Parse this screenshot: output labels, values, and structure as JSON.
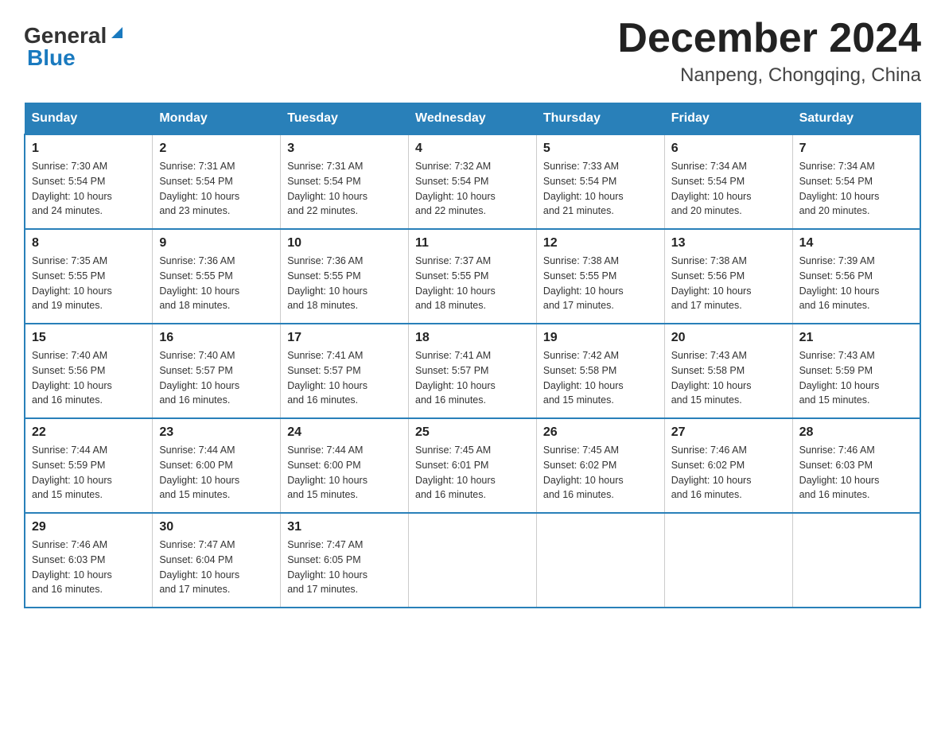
{
  "header": {
    "logo_general": "General",
    "logo_blue": "Blue",
    "month_title": "December 2024",
    "location": "Nanpeng, Chongqing, China"
  },
  "days_of_week": [
    "Sunday",
    "Monday",
    "Tuesday",
    "Wednesday",
    "Thursday",
    "Friday",
    "Saturday"
  ],
  "weeks": [
    [
      {
        "day": "1",
        "sunrise": "7:30 AM",
        "sunset": "5:54 PM",
        "daylight": "10 hours and 24 minutes."
      },
      {
        "day": "2",
        "sunrise": "7:31 AM",
        "sunset": "5:54 PM",
        "daylight": "10 hours and 23 minutes."
      },
      {
        "day": "3",
        "sunrise": "7:31 AM",
        "sunset": "5:54 PM",
        "daylight": "10 hours and 22 minutes."
      },
      {
        "day": "4",
        "sunrise": "7:32 AM",
        "sunset": "5:54 PM",
        "daylight": "10 hours and 22 minutes."
      },
      {
        "day": "5",
        "sunrise": "7:33 AM",
        "sunset": "5:54 PM",
        "daylight": "10 hours and 21 minutes."
      },
      {
        "day": "6",
        "sunrise": "7:34 AM",
        "sunset": "5:54 PM",
        "daylight": "10 hours and 20 minutes."
      },
      {
        "day": "7",
        "sunrise": "7:34 AM",
        "sunset": "5:54 PM",
        "daylight": "10 hours and 20 minutes."
      }
    ],
    [
      {
        "day": "8",
        "sunrise": "7:35 AM",
        "sunset": "5:55 PM",
        "daylight": "10 hours and 19 minutes."
      },
      {
        "day": "9",
        "sunrise": "7:36 AM",
        "sunset": "5:55 PM",
        "daylight": "10 hours and 18 minutes."
      },
      {
        "day": "10",
        "sunrise": "7:36 AM",
        "sunset": "5:55 PM",
        "daylight": "10 hours and 18 minutes."
      },
      {
        "day": "11",
        "sunrise": "7:37 AM",
        "sunset": "5:55 PM",
        "daylight": "10 hours and 18 minutes."
      },
      {
        "day": "12",
        "sunrise": "7:38 AM",
        "sunset": "5:55 PM",
        "daylight": "10 hours and 17 minutes."
      },
      {
        "day": "13",
        "sunrise": "7:38 AM",
        "sunset": "5:56 PM",
        "daylight": "10 hours and 17 minutes."
      },
      {
        "day": "14",
        "sunrise": "7:39 AM",
        "sunset": "5:56 PM",
        "daylight": "10 hours and 16 minutes."
      }
    ],
    [
      {
        "day": "15",
        "sunrise": "7:40 AM",
        "sunset": "5:56 PM",
        "daylight": "10 hours and 16 minutes."
      },
      {
        "day": "16",
        "sunrise": "7:40 AM",
        "sunset": "5:57 PM",
        "daylight": "10 hours and 16 minutes."
      },
      {
        "day": "17",
        "sunrise": "7:41 AM",
        "sunset": "5:57 PM",
        "daylight": "10 hours and 16 minutes."
      },
      {
        "day": "18",
        "sunrise": "7:41 AM",
        "sunset": "5:57 PM",
        "daylight": "10 hours and 16 minutes."
      },
      {
        "day": "19",
        "sunrise": "7:42 AM",
        "sunset": "5:58 PM",
        "daylight": "10 hours and 15 minutes."
      },
      {
        "day": "20",
        "sunrise": "7:43 AM",
        "sunset": "5:58 PM",
        "daylight": "10 hours and 15 minutes."
      },
      {
        "day": "21",
        "sunrise": "7:43 AM",
        "sunset": "5:59 PM",
        "daylight": "10 hours and 15 minutes."
      }
    ],
    [
      {
        "day": "22",
        "sunrise": "7:44 AM",
        "sunset": "5:59 PM",
        "daylight": "10 hours and 15 minutes."
      },
      {
        "day": "23",
        "sunrise": "7:44 AM",
        "sunset": "6:00 PM",
        "daylight": "10 hours and 15 minutes."
      },
      {
        "day": "24",
        "sunrise": "7:44 AM",
        "sunset": "6:00 PM",
        "daylight": "10 hours and 15 minutes."
      },
      {
        "day": "25",
        "sunrise": "7:45 AM",
        "sunset": "6:01 PM",
        "daylight": "10 hours and 16 minutes."
      },
      {
        "day": "26",
        "sunrise": "7:45 AM",
        "sunset": "6:02 PM",
        "daylight": "10 hours and 16 minutes."
      },
      {
        "day": "27",
        "sunrise": "7:46 AM",
        "sunset": "6:02 PM",
        "daylight": "10 hours and 16 minutes."
      },
      {
        "day": "28",
        "sunrise": "7:46 AM",
        "sunset": "6:03 PM",
        "daylight": "10 hours and 16 minutes."
      }
    ],
    [
      {
        "day": "29",
        "sunrise": "7:46 AM",
        "sunset": "6:03 PM",
        "daylight": "10 hours and 16 minutes."
      },
      {
        "day": "30",
        "sunrise": "7:47 AM",
        "sunset": "6:04 PM",
        "daylight": "10 hours and 17 minutes."
      },
      {
        "day": "31",
        "sunrise": "7:47 AM",
        "sunset": "6:05 PM",
        "daylight": "10 hours and 17 minutes."
      },
      null,
      null,
      null,
      null
    ]
  ],
  "labels": {
    "sunrise": "Sunrise:",
    "sunset": "Sunset:",
    "daylight": "Daylight:"
  }
}
